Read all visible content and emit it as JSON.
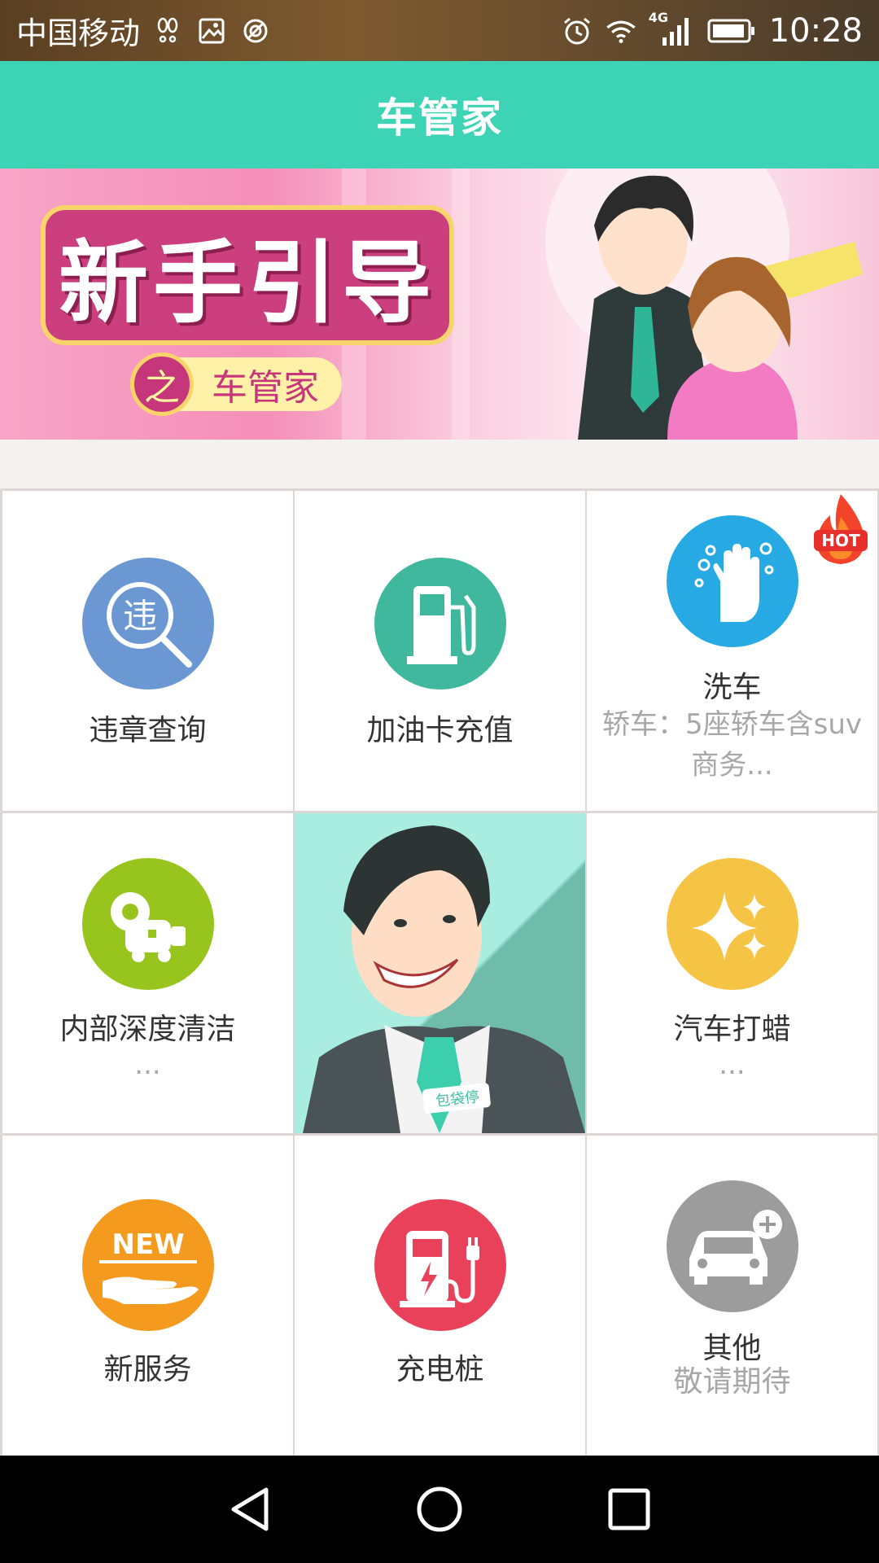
{
  "status_bar": {
    "carrier": "中国移动",
    "network": "4G",
    "time": "10:28"
  },
  "header": {
    "title": "车管家"
  },
  "banner": {
    "title": "新手引导",
    "badge": "之",
    "subtitle": "车管家",
    "slide_count": 3,
    "active_slide": 2
  },
  "services": [
    {
      "label": "违章查询",
      "icon": "violation-search-icon",
      "color": "#6b98d3",
      "glyph": "违"
    },
    {
      "label": "加油卡充值",
      "icon": "fuel-pump-icon",
      "color": "#3fb89e"
    },
    {
      "label": "洗车",
      "sublabel": "轿车：5座轿车含suv商务...",
      "icon": "hand-wash-icon",
      "color": "#27a9e4",
      "badge": "HOT"
    },
    {
      "label": "内部深度清洁",
      "sublabel": "...",
      "icon": "vacuum-cleaner-icon",
      "color": "#98c51d"
    },
    {
      "label": "汽车打蜡",
      "sublabel": "...",
      "icon": "sparkle-icon",
      "color": "#f6c444"
    },
    {
      "label": "新服务",
      "icon": "new-service-icon",
      "color": "#f39a1f",
      "glyph": "NEW"
    },
    {
      "label": "充电桩",
      "icon": "charging-station-icon",
      "color": "#e9415a"
    },
    {
      "label": "其他",
      "sublabel": "敬请期待",
      "icon": "car-add-icon",
      "color": "#9c9c9c"
    }
  ],
  "promo": {
    "badge_text": "包袋停"
  }
}
